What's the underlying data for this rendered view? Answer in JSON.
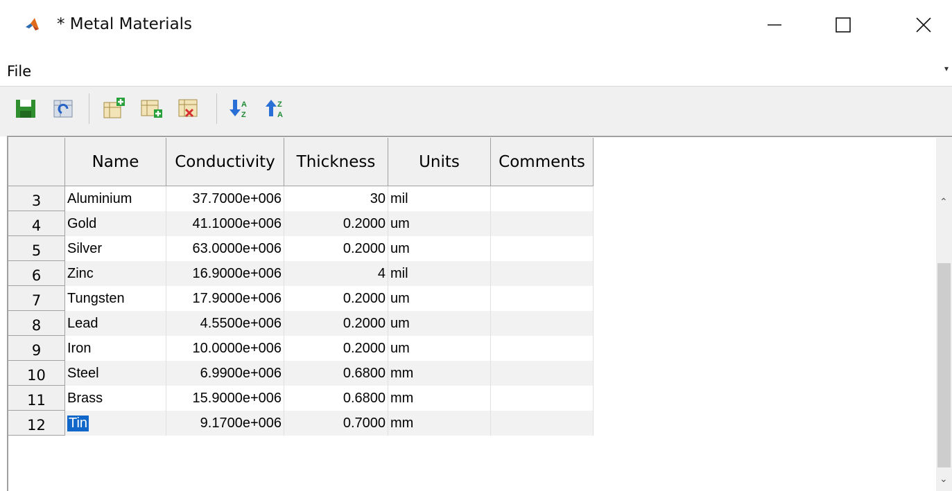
{
  "window": {
    "title": "* Metal Materials",
    "app_icon": "matlab-icon",
    "controls": [
      "minimize-icon",
      "maximize-icon",
      "close-icon"
    ]
  },
  "menu": {
    "items": [
      "File"
    ]
  },
  "toolbar": {
    "buttons": [
      "save-icon",
      "refresh-table-icon",
      "add-row-icon",
      "insert-row-icon",
      "delete-row-icon",
      "sort-descending-icon",
      "sort-ascending-icon"
    ]
  },
  "table": {
    "columns": [
      "Name",
      "Conductivity",
      "Thickness",
      "Units",
      "Comments"
    ],
    "rows": [
      {
        "index": "3",
        "name": "Aluminium",
        "conductivity": "37.7000e+006",
        "thickness": "30",
        "units": "mil",
        "comments": ""
      },
      {
        "index": "4",
        "name": "Gold",
        "conductivity": "41.1000e+006",
        "thickness": "0.2000",
        "units": "um",
        "comments": ""
      },
      {
        "index": "5",
        "name": "Silver",
        "conductivity": "63.0000e+006",
        "thickness": "0.2000",
        "units": "um",
        "comments": ""
      },
      {
        "index": "6",
        "name": "Zinc",
        "conductivity": "16.9000e+006",
        "thickness": "4",
        "units": "mil",
        "comments": ""
      },
      {
        "index": "7",
        "name": "Tungsten",
        "conductivity": "17.9000e+006",
        "thickness": "0.2000",
        "units": "um",
        "comments": ""
      },
      {
        "index": "8",
        "name": "Lead",
        "conductivity": "4.5500e+006",
        "thickness": "0.2000",
        "units": "um",
        "comments": ""
      },
      {
        "index": "9",
        "name": "Iron",
        "conductivity": "10.0000e+006",
        "thickness": "0.2000",
        "units": "um",
        "comments": ""
      },
      {
        "index": "10",
        "name": "Steel",
        "conductivity": "6.9900e+006",
        "thickness": "0.6800",
        "units": "mm",
        "comments": ""
      },
      {
        "index": "11",
        "name": "Brass",
        "conductivity": "15.9000e+006",
        "thickness": "0.6800",
        "units": "mm",
        "comments": ""
      },
      {
        "index": "12",
        "name": "Tin",
        "conductivity": "9.1700e+006",
        "thickness": "0.7000",
        "units": "mm",
        "comments": ""
      }
    ],
    "selected_row": "12",
    "selection_color": "#1167c9"
  }
}
